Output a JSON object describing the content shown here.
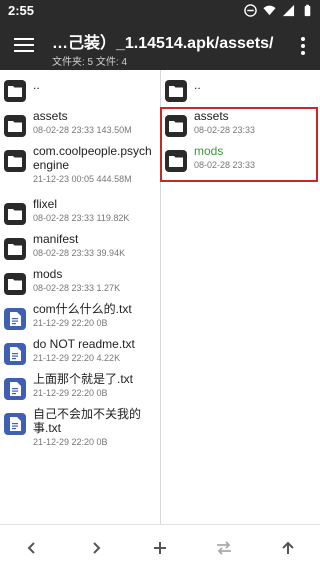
{
  "status_bar": {
    "time": "2:55"
  },
  "app_bar": {
    "title": "…己装）_1.14514.apk/assets/",
    "subtitle": "文件夹: 5  文件: 4"
  },
  "left_pane": {
    "items": [
      {
        "name": "..",
        "meta": "",
        "type": "folder"
      },
      {
        "name": "assets",
        "meta": "08-02-28 23:33  143.50M",
        "type": "folder"
      },
      {
        "name": "com.coolpeople.psychengine",
        "meta": "21-12-23 00:05  444.58M",
        "type": "folder"
      },
      {
        "name": "flixel",
        "meta": "08-02-28 23:33  119.82K",
        "type": "folder"
      },
      {
        "name": "manifest",
        "meta": "08-02-28 23:33  39.94K",
        "type": "folder"
      },
      {
        "name": "mods",
        "meta": "08-02-28 23:33  1.27K",
        "type": "folder"
      },
      {
        "name": "com什么什么的.txt",
        "meta": "21-12-29 22:20  0B",
        "type": "file"
      },
      {
        "name": "do NOT readme.txt",
        "meta": "21-12-29 22:20  4.22K",
        "type": "file"
      },
      {
        "name": "上面那个就是了.txt",
        "meta": "21-12-29 22:20  0B",
        "type": "file"
      },
      {
        "name": "自己不会加不关我的事.txt",
        "meta": "21-12-29 22:20  0B",
        "type": "file"
      }
    ]
  },
  "right_pane": {
    "items": [
      {
        "name": "..",
        "meta": "",
        "type": "folder"
      },
      {
        "name": "assets",
        "meta": "08-02-28 23:33",
        "type": "folder"
      },
      {
        "name": "mods",
        "meta": "08-02-28 23:33",
        "type": "folder",
        "color": "#3a9a3a"
      }
    ]
  },
  "colors": {
    "bar_bg": "#2b2b2b",
    "highlight": "#c62828",
    "folder_icon": "#2a2a2a",
    "file_icon": "#3f5fb5",
    "accent_green": "#3a9a3a"
  }
}
